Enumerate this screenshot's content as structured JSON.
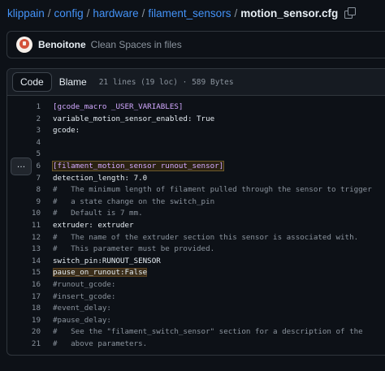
{
  "breadcrumb": {
    "repo": "klippain",
    "parts": [
      "config",
      "hardware",
      "filament_sensors"
    ],
    "file": "motion_sensor.cfg",
    "separator": "/"
  },
  "commit": {
    "author": "Benoitone",
    "message": "Clean Spaces in files"
  },
  "viewer": {
    "tabs": [
      "Code",
      "Blame"
    ],
    "active_tab": "Code",
    "stats": "21 lines (19 loc) · 589 Bytes",
    "expand_label": "…"
  },
  "lines": [
    {
      "n": "1",
      "t": "[gcode_macro _USER_VARIABLES]"
    },
    {
      "n": "2",
      "t": "variable_motion_sensor_enabled: True"
    },
    {
      "n": "3",
      "t": "gcode:"
    },
    {
      "n": "4",
      "t": ""
    },
    {
      "n": "5",
      "t": ""
    },
    {
      "n": "6",
      "t": "[filament_motion_sensor runout_sensor]"
    },
    {
      "n": "7",
      "t": "detection_length: 7.0"
    },
    {
      "n": "8",
      "t": "#   The minimum length of filament pulled through the sensor to trigger"
    },
    {
      "n": "9",
      "t": "#   a state change on the switch_pin"
    },
    {
      "n": "10",
      "t": "#   Default is 7 mm."
    },
    {
      "n": "11",
      "t": "extruder: extruder"
    },
    {
      "n": "12",
      "t": "#   The name of the extruder section this sensor is associated with."
    },
    {
      "n": "13",
      "t": "#   This parameter must be provided."
    },
    {
      "n": "14",
      "t": "switch_pin:RUNOUT_SENSOR"
    },
    {
      "n": "15",
      "t": "pause_on_runout:False"
    },
    {
      "n": "16",
      "t": "#runout_gcode:"
    },
    {
      "n": "17",
      "t": "#insert_gcode:"
    },
    {
      "n": "18",
      "t": "#event_delay:"
    },
    {
      "n": "19",
      "t": "#pause_delay:"
    },
    {
      "n": "20",
      "t": "#   See the \"filament_switch_sensor\" section for a description of the"
    },
    {
      "n": "21",
      "t": "#   above parameters."
    }
  ],
  "colors": {
    "background": "#0d1117",
    "link": "#4493f8",
    "section": "#d2a8ff",
    "comment": "#8b949e",
    "highlight": "#3b2e1a"
  }
}
